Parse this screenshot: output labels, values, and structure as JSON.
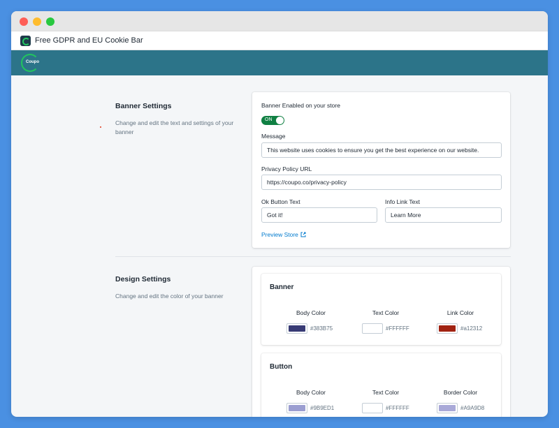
{
  "window": {
    "title": "Free GDPR and EU Cookie Bar"
  },
  "brand": {
    "logo_text": "Coupo"
  },
  "banner_settings": {
    "title": "Banner Settings",
    "description": "Change and edit the text and settings of your banner",
    "enabled_label": "Banner Enabled on your store",
    "toggle_label": "ON",
    "message_label": "Message",
    "message_value": "This website uses cookies to ensure you get the best experience on our website.",
    "privacy_label": "Privacy Policy URL",
    "privacy_value": "https://coupo.co/privacy-policy",
    "ok_label": "Ok Button Text",
    "ok_value": "Got it!",
    "info_label": "Info Link Text",
    "info_value": "Learn More",
    "preview_link": "Preview Store"
  },
  "design_settings": {
    "title": "Design Settings",
    "description": "Change and edit the color of your banner",
    "banner": {
      "title": "Banner",
      "columns": [
        {
          "label": "Body Color",
          "hex": "#383B75",
          "color": "#383B75"
        },
        {
          "label": "Text Color",
          "hex": "#FFFFFF",
          "color": "#FFFFFF"
        },
        {
          "label": "Link Color",
          "hex": "#a12312",
          "color": "#a12312"
        }
      ]
    },
    "button": {
      "title": "Button",
      "columns": [
        {
          "label": "Body Color",
          "hex": "#9B9ED1",
          "color": "#9B9ED1"
        },
        {
          "label": "Text Color",
          "hex": "#FFFFFF",
          "color": "#FFFFFF"
        },
        {
          "label": "Border Color",
          "hex": "#A9A9D8",
          "color": "#A9A9D8"
        }
      ]
    }
  },
  "colors": {
    "brand_bar": "#2c7489",
    "toggle_on": "#108043",
    "link": "#007ace"
  }
}
